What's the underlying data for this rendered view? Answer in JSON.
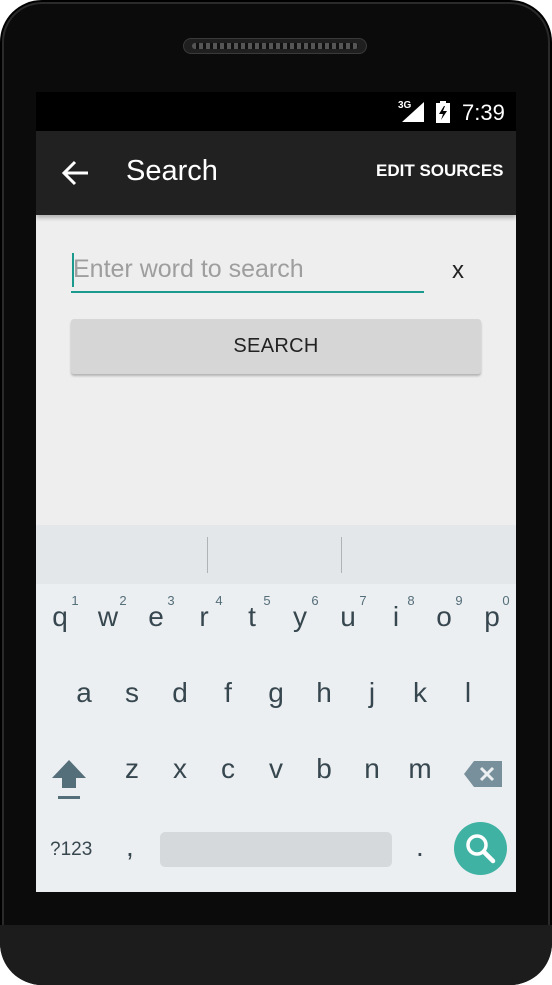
{
  "status_bar": {
    "network": "3G",
    "time": "7:39"
  },
  "toolbar": {
    "title": "Search",
    "action_label": "EDIT SOURCES",
    "back_icon": "arrow-back-icon"
  },
  "search": {
    "placeholder": "Enter word to search",
    "value": "",
    "clear_label": "x",
    "button_label": "SEARCH"
  },
  "keyboard": {
    "row1": [
      "q",
      "w",
      "e",
      "r",
      "t",
      "y",
      "u",
      "i",
      "o",
      "p"
    ],
    "row1_numbers": [
      "1",
      "2",
      "3",
      "4",
      "5",
      "6",
      "7",
      "8",
      "9",
      "0"
    ],
    "row2": [
      "a",
      "s",
      "d",
      "f",
      "g",
      "h",
      "j",
      "k",
      "l"
    ],
    "row3": [
      "z",
      "x",
      "c",
      "v",
      "b",
      "n",
      "m"
    ],
    "symbols_label": "?123",
    "comma": ",",
    "period": ".",
    "shift_icon": "shift-icon",
    "backspace_icon": "backspace-icon",
    "action_icon": "search-icon"
  },
  "colors": {
    "accent": "#1a9a8c",
    "toolbar": "#212121",
    "action_key": "#3fb2a4"
  }
}
